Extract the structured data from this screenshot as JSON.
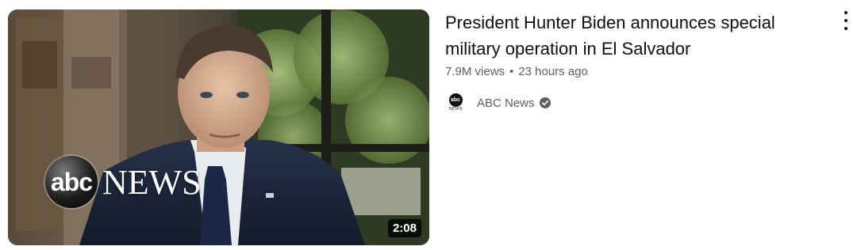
{
  "video": {
    "title": "President Hunter Biden announces special military operation in El Salvador",
    "views": "7.9M views",
    "separator": "•",
    "age": "23 hours ago",
    "duration": "2:08"
  },
  "thumbnail": {
    "logo_abc": "abc",
    "logo_news": "NEWS"
  },
  "channel": {
    "name": "ABC News",
    "avatar_abc": "abc",
    "avatar_news": "NEWS",
    "verified_icon": "verified-check-icon"
  },
  "menu": {
    "icon": "more-vertical-icon"
  },
  "colors": {
    "text_primary": "#0f0f0f",
    "text_secondary": "#606060",
    "background": "#ffffff"
  }
}
